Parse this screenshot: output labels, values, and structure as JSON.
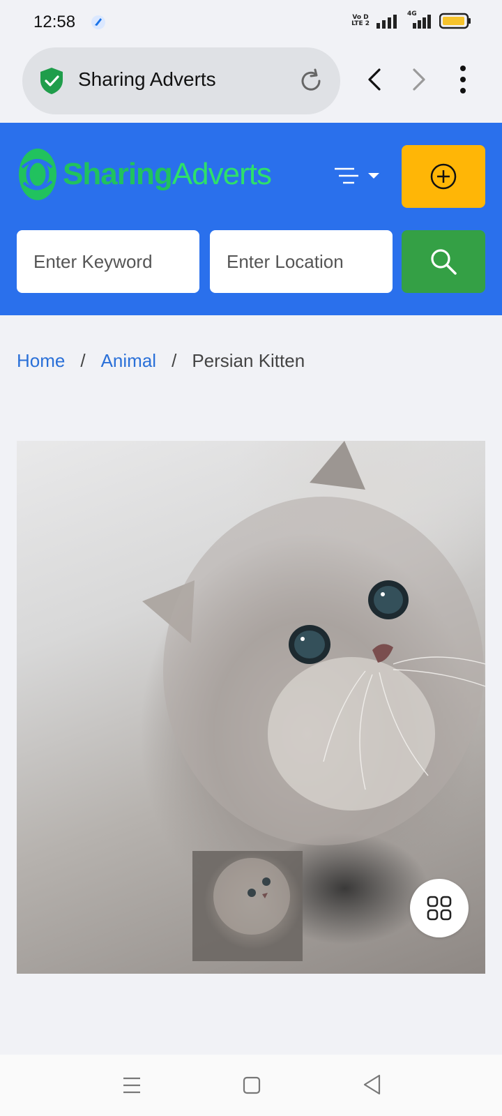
{
  "status_bar": {
    "time": "12:58",
    "volte_top": "Vo D",
    "volte_bottom": "LTE 2",
    "net_label": "4G",
    "battery_color": "#f6c32c"
  },
  "browser": {
    "page_title": "Sharing Adverts",
    "icons": [
      "shield-check-icon",
      "reload-icon",
      "back-arrow-icon",
      "forward-arrow-icon",
      "more-vert-icon"
    ]
  },
  "header": {
    "logo_part1": "Sharing",
    "logo_part2": "Adverts",
    "brand_color": "#2a70ec",
    "post_button_color": "#ffb606",
    "search_button_color": "#34a045",
    "keyword_placeholder": "Enter Keyword",
    "location_placeholder": "Enter Location"
  },
  "breadcrumb": {
    "home": "Home",
    "category": "Animal",
    "separator": "/",
    "current": "Persian Kitten"
  },
  "gallery": {
    "main_image": "Persian Kitten",
    "thumbnail_image": "Persian Kitten",
    "view_all_icon": "grid-icon"
  },
  "system_nav": {
    "icons": [
      "recents-icon",
      "home-icon",
      "back-icon"
    ]
  }
}
